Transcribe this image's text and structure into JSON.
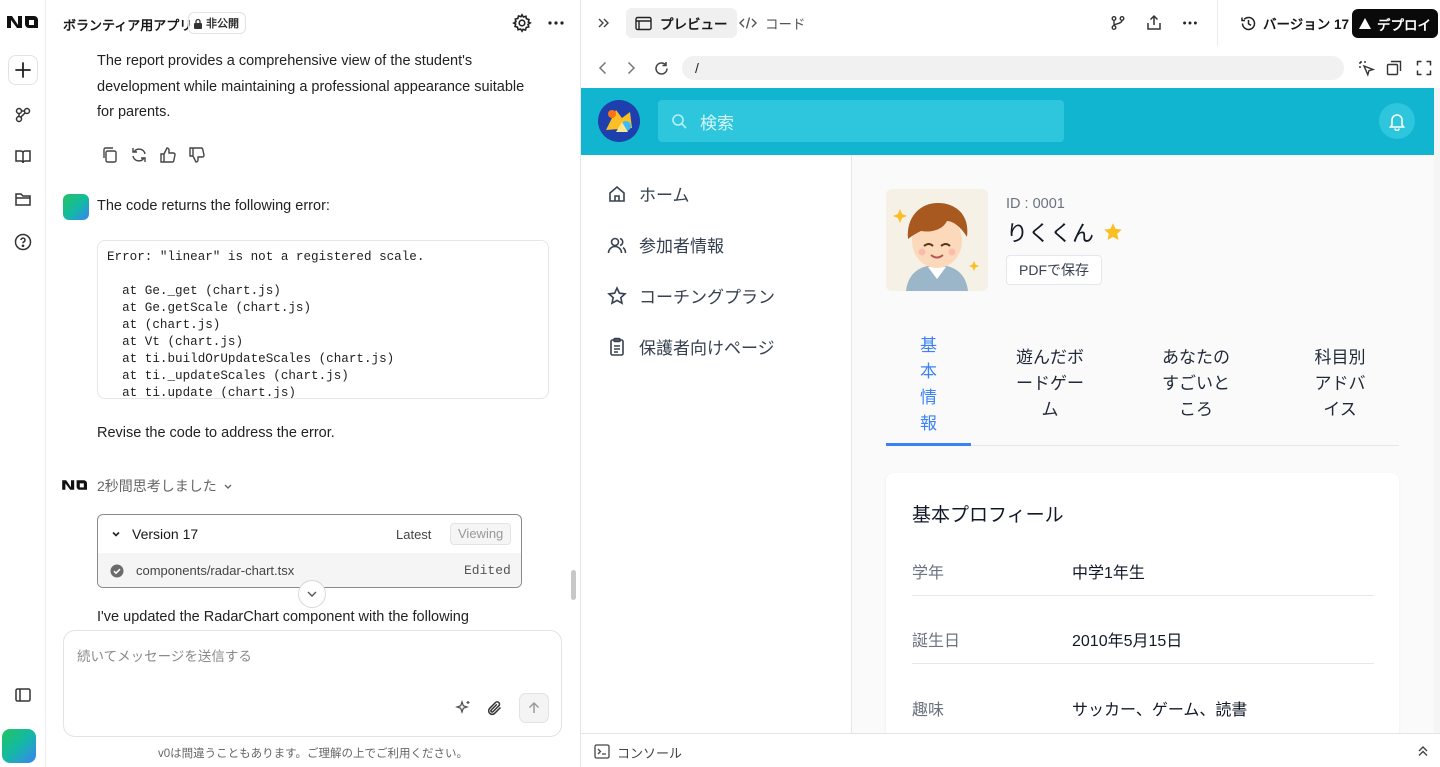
{
  "chat": {
    "project_title": "ボランティア用アプリ",
    "visibility_badge": "非公開",
    "assistant_paragraph": "The report provides a comprehensive view of the student's development while maintaining a professional appearance suitable for parents.",
    "user_message_intro": "The code returns the following error:",
    "error_code": "Error: \"linear\" is not a registered scale.\n\n  at Ge._get (chart.js)\n  at Ge.getScale (chart.js)\n  at (chart.js)\n  at Vt (chart.js)\n  at ti.buildOrUpdateScales (chart.js)\n  at ti._updateScales (chart.js)\n  at ti.update (chart.js)",
    "user_message_outro": "Revise the code to address the error.",
    "thinking_label": "2秒間思考しました",
    "version_card": {
      "title": "Version 17",
      "latest_label": "Latest",
      "viewing_label": "Viewing",
      "file_name": "components/radar-chart.tsx",
      "file_status": "Edited"
    },
    "response_start": "I've updated the RadarChart component with the following",
    "input_placeholder": "続いてメッセージを送信する",
    "disclaimer": "v0は間違うこともあります。ご理解の上でご利用ください。"
  },
  "topbar": {
    "preview_tab": "プレビュー",
    "code_tab": "コード",
    "version_label": "バージョン 17",
    "deploy_label": "デプロイ"
  },
  "urlbar": {
    "path": "/"
  },
  "app": {
    "search_placeholder": "検索",
    "nav": [
      {
        "label": "ホーム",
        "icon": "home-icon"
      },
      {
        "label": "参加者情報",
        "icon": "users-icon"
      },
      {
        "label": "コーチングプラン",
        "icon": "star-icon"
      },
      {
        "label": "保護者向けページ",
        "icon": "clipboard-icon"
      }
    ],
    "profile": {
      "id_text": "ID : 0001",
      "name": "りくくん",
      "pdf_button": "PDFで保存"
    },
    "tabs": [
      {
        "label": "基本情報",
        "lines": [
          "基",
          "本",
          "情",
          "報"
        ]
      },
      {
        "label": "遊んだボードゲーム",
        "lines": [
          "遊んだボ",
          "ードゲー",
          "ム"
        ]
      },
      {
        "label": "あなたのすごいところ",
        "lines": [
          "あなたの",
          "すごいと",
          "ころ"
        ]
      },
      {
        "label": "科目別アドバイス",
        "lines": [
          "科目別",
          "アドバ",
          "イス"
        ]
      }
    ],
    "basic_profile": {
      "heading": "基本プロフィール",
      "rows": [
        {
          "label": "学年",
          "value": "中学1年生"
        },
        {
          "label": "誕生日",
          "value": "2010年5月15日"
        },
        {
          "label": "趣味",
          "value": "サッカー、ゲーム、読書"
        }
      ]
    },
    "colors": {
      "header": "#12b5cf",
      "active_tab": "#3b82f6",
      "star": "#fbbf24"
    }
  },
  "console": {
    "label": "コンソール"
  }
}
